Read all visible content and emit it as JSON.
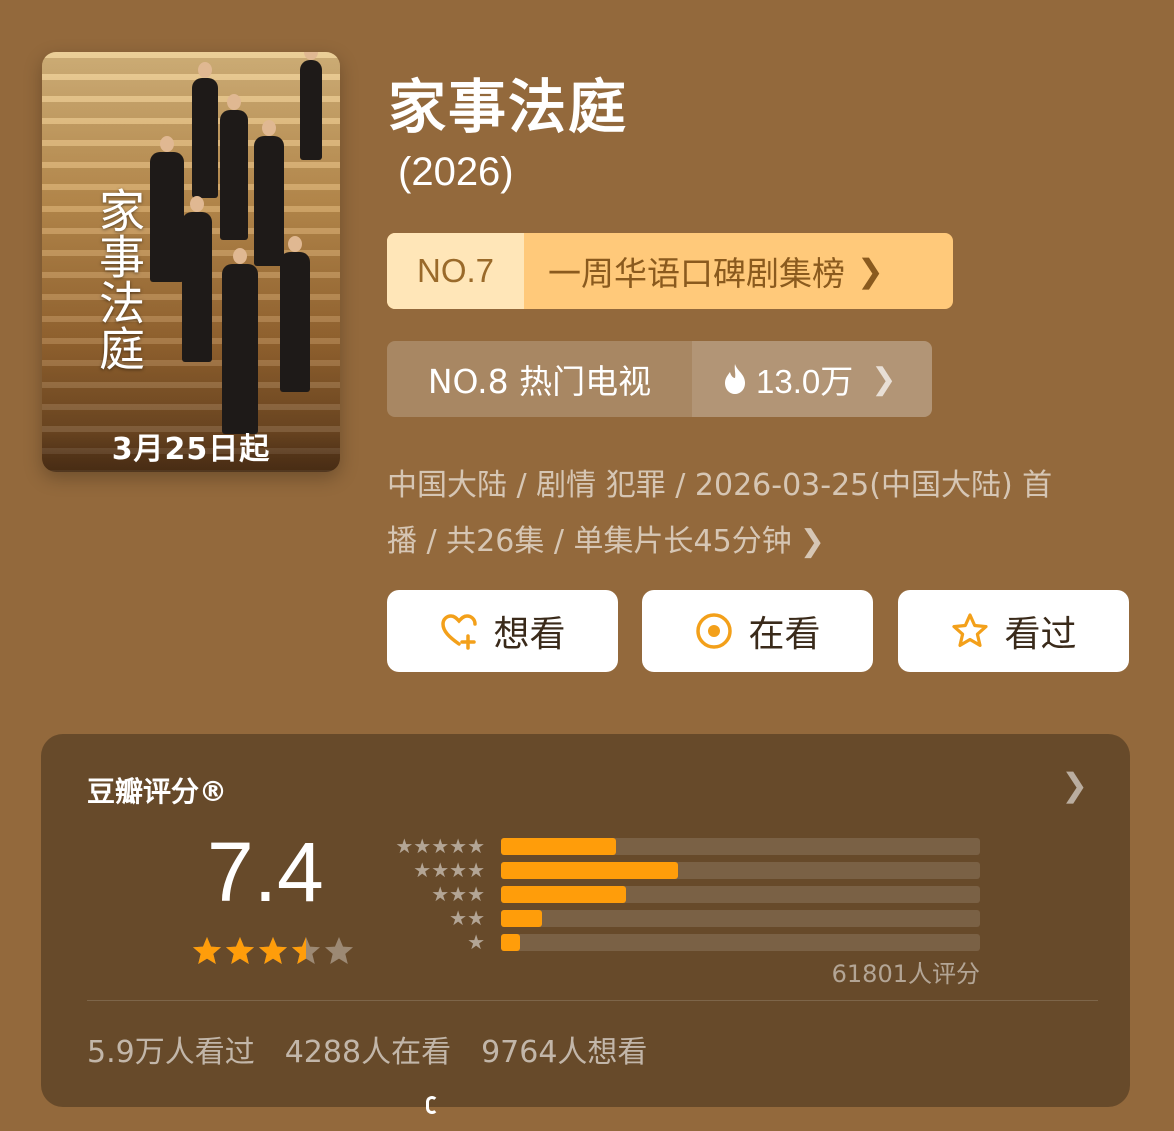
{
  "poster": {
    "title": "家事法庭",
    "date": "3月25日起"
  },
  "header": {
    "title": "家事法庭",
    "year": "(2026)"
  },
  "ranks": {
    "primary": {
      "rank": "NO.7",
      "label": "一周华语口碑剧集榜"
    },
    "secondary": {
      "rank": "NO.8 热门电视",
      "heat": "13.0万"
    }
  },
  "meta": {
    "line1": "中国大陆 / 剧情 犯罪 / 2026-03-25(中国大陆) 首",
    "line2": "播 / 共26集 / 单集片长45分钟"
  },
  "actions": {
    "want": "想看",
    "doing": "在看",
    "done": "看过"
  },
  "rating": {
    "heading": "豆瓣评分®",
    "score": "7.4",
    "stars_value": 3.5,
    "distribution": [
      {
        "stars": 5,
        "fraction": 0.24
      },
      {
        "stars": 4,
        "fraction": 0.37
      },
      {
        "stars": 3,
        "fraction": 0.26
      },
      {
        "stars": 2,
        "fraction": 0.085
      },
      {
        "stars": 1,
        "fraction": 0.04
      }
    ],
    "count": "61801人评分",
    "stats": [
      "5.9万人看过",
      "4288人在看",
      "9764人想看"
    ]
  },
  "colors": {
    "background": "#93693c",
    "accent": "#ff9d0a",
    "card": "#674a2a"
  }
}
